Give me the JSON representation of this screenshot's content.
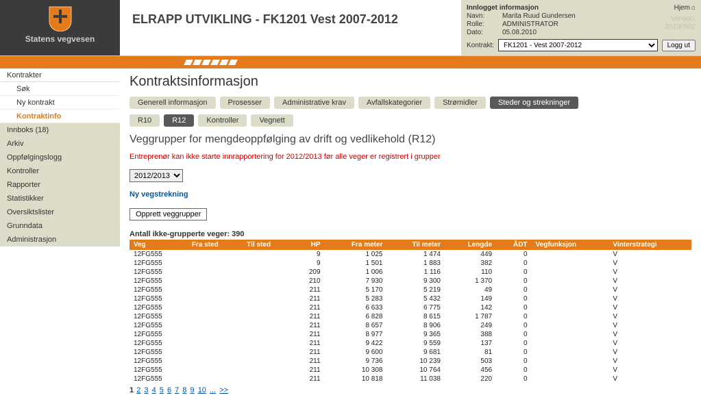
{
  "brand": "Statens vegvesen",
  "app_title": "ELRAPP UTVIKLING - FK1201 Vest 2007-2012",
  "home": "Hjem",
  "info": {
    "title": "Innlogget informasjon",
    "navn_lbl": "Navn:",
    "navn": "Marita Ruud Gundersen",
    "rolle_lbl": "Rolle:",
    "rolle": "ADMINISTRATOR",
    "dato_lbl": "Dato:",
    "dato": "05.08.2010",
    "versjon_lbl": "Versjon:",
    "versjon": "20100502",
    "kontrakt_lbl": "Kontrakt:",
    "kontrakt_sel": "FK1201 - Vest 2007-2012",
    "logg_ut": "Logg ut"
  },
  "sidebar": [
    {
      "label": "Kontrakter",
      "type": "item",
      "active": true
    },
    {
      "label": "Søk",
      "type": "sub"
    },
    {
      "label": "Ny kontrakt",
      "type": "sub"
    },
    {
      "label": "Kontraktinfo",
      "type": "sub",
      "current": true
    },
    {
      "label": "Innboks (18)",
      "type": "item"
    },
    {
      "label": "Arkiv",
      "type": "item"
    },
    {
      "label": "Oppfølgingslogg",
      "type": "item"
    },
    {
      "label": "Kontroller",
      "type": "item"
    },
    {
      "label": "Rapporter",
      "type": "item"
    },
    {
      "label": "Statistikker",
      "type": "item"
    },
    {
      "label": "Oversiktslister",
      "type": "item"
    },
    {
      "label": "Grunndata",
      "type": "item"
    },
    {
      "label": "Administrasjon",
      "type": "item"
    }
  ],
  "page_title": "Kontraktsinformasjon",
  "main_tabs": [
    {
      "label": "Generell informasjon"
    },
    {
      "label": "Prosesser"
    },
    {
      "label": "Administrative krav"
    },
    {
      "label": "Avfallskategorier"
    },
    {
      "label": "Strømidler"
    },
    {
      "label": "Steder og strekninger",
      "active": true
    }
  ],
  "sub_tabs": [
    {
      "label": "R10"
    },
    {
      "label": "R12",
      "active": true
    },
    {
      "label": "Kontroller"
    },
    {
      "label": "Vegnett"
    }
  ],
  "section_title": "Veggrupper for mengdeoppfølging av drift og vedlikehold (R12)",
  "warn": "Entreprenør kan ikke starte innrapportering for 2012/2013 før alle veger er registrert i grupper",
  "year_sel": "2012/2013",
  "ny_veg": "Ny vegstrekning",
  "opprett": "Opprett veggrupper",
  "count_label": "Antall ikke-grupperte veger: 390",
  "thead": [
    "Veg",
    "Fra sted",
    "Til sted",
    "HP",
    "Fra meter",
    "Til meter",
    "Lengde",
    "ÅDT",
    "Vegfunksjon",
    "Vinterstrategi"
  ],
  "rows": [
    {
      "veg": "12FG555",
      "fra_sted": "",
      "til_sted": "",
      "hp": "9",
      "fra_m": "1 025",
      "til_m": "1 474",
      "len": "449",
      "adt": "0",
      "vegf": "",
      "vint": "V"
    },
    {
      "veg": "12FG555",
      "fra_sted": "",
      "til_sted": "",
      "hp": "9",
      "fra_m": "1 501",
      "til_m": "1 883",
      "len": "382",
      "adt": "0",
      "vegf": "",
      "vint": "V"
    },
    {
      "veg": "12FG555",
      "fra_sted": "",
      "til_sted": "",
      "hp": "209",
      "fra_m": "1 006",
      "til_m": "1 116",
      "len": "110",
      "adt": "0",
      "vegf": "",
      "vint": "V"
    },
    {
      "veg": "12FG555",
      "fra_sted": "",
      "til_sted": "",
      "hp": "210",
      "fra_m": "7 930",
      "til_m": "9 300",
      "len": "1 370",
      "adt": "0",
      "vegf": "",
      "vint": "V"
    },
    {
      "veg": "12FG555",
      "fra_sted": "",
      "til_sted": "",
      "hp": "211",
      "fra_m": "5 170",
      "til_m": "5 219",
      "len": "49",
      "adt": "0",
      "vegf": "",
      "vint": "V"
    },
    {
      "veg": "12FG555",
      "fra_sted": "",
      "til_sted": "",
      "hp": "211",
      "fra_m": "5 283",
      "til_m": "5 432",
      "len": "149",
      "adt": "0",
      "vegf": "",
      "vint": "V"
    },
    {
      "veg": "12FG555",
      "fra_sted": "",
      "til_sted": "",
      "hp": "211",
      "fra_m": "6 633",
      "til_m": "6 775",
      "len": "142",
      "adt": "0",
      "vegf": "",
      "vint": "V"
    },
    {
      "veg": "12FG555",
      "fra_sted": "",
      "til_sted": "",
      "hp": "211",
      "fra_m": "6 828",
      "til_m": "8 615",
      "len": "1 787",
      "adt": "0",
      "vegf": "",
      "vint": "V"
    },
    {
      "veg": "12FG555",
      "fra_sted": "",
      "til_sted": "",
      "hp": "211",
      "fra_m": "8 657",
      "til_m": "8 906",
      "len": "249",
      "adt": "0",
      "vegf": "",
      "vint": "V"
    },
    {
      "veg": "12FG555",
      "fra_sted": "",
      "til_sted": "",
      "hp": "211",
      "fra_m": "8 977",
      "til_m": "9 365",
      "len": "388",
      "adt": "0",
      "vegf": "",
      "vint": "V"
    },
    {
      "veg": "12FG555",
      "fra_sted": "",
      "til_sted": "",
      "hp": "211",
      "fra_m": "9 422",
      "til_m": "9 559",
      "len": "137",
      "adt": "0",
      "vegf": "",
      "vint": "V"
    },
    {
      "veg": "12FG555",
      "fra_sted": "",
      "til_sted": "",
      "hp": "211",
      "fra_m": "9 600",
      "til_m": "9 681",
      "len": "81",
      "adt": "0",
      "vegf": "",
      "vint": "V"
    },
    {
      "veg": "12FG555",
      "fra_sted": "",
      "til_sted": "",
      "hp": "211",
      "fra_m": "9 736",
      "til_m": "10 239",
      "len": "503",
      "adt": "0",
      "vegf": "",
      "vint": "V"
    },
    {
      "veg": "12FG555",
      "fra_sted": "",
      "til_sted": "",
      "hp": "211",
      "fra_m": "10 308",
      "til_m": "10 764",
      "len": "456",
      "adt": "0",
      "vegf": "",
      "vint": "V"
    },
    {
      "veg": "12FG555",
      "fra_sted": "",
      "til_sted": "",
      "hp": "211",
      "fra_m": "10 818",
      "til_m": "11 038",
      "len": "220",
      "adt": "0",
      "vegf": "",
      "vint": "V"
    }
  ],
  "pager": {
    "current": "1",
    "pages": [
      "2",
      "3",
      "4",
      "5",
      "6",
      "7",
      "8",
      "9",
      "10"
    ],
    "ellipsis": "...",
    "next": ">>"
  }
}
